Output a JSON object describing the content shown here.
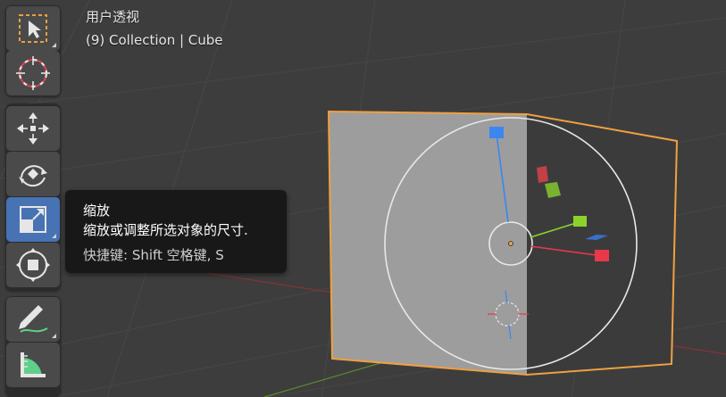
{
  "viewport": {
    "view_name": "用户透视",
    "collection_info": "(9) Collection | Cube"
  },
  "toolbar": {
    "tools": [
      {
        "name": "select-box",
        "icon": "select-box-icon",
        "active": false
      },
      {
        "name": "cursor",
        "icon": "cursor-icon",
        "active": false
      },
      {
        "name": "move",
        "icon": "move-icon",
        "active": false
      },
      {
        "name": "rotate",
        "icon": "rotate-icon",
        "active": false
      },
      {
        "name": "scale",
        "icon": "scale-icon",
        "active": true
      },
      {
        "name": "transform",
        "icon": "transform-icon",
        "active": false
      },
      {
        "name": "annotate",
        "icon": "annotate-icon",
        "active": false
      },
      {
        "name": "measure",
        "icon": "measure-icon",
        "active": false
      }
    ]
  },
  "tooltip": {
    "title": "缩放",
    "description": "缩放或调整所选对象的尺寸.",
    "shortcut": "快捷键: Shift 空格键, S"
  },
  "colors": {
    "viewport_bg": "#3d3d3d",
    "active_tool": "#4772b3",
    "selection_outline": "#f0a040",
    "x_axis": "#e8384a",
    "y_axis": "#8bd32a",
    "z_axis": "#3b86f0"
  }
}
